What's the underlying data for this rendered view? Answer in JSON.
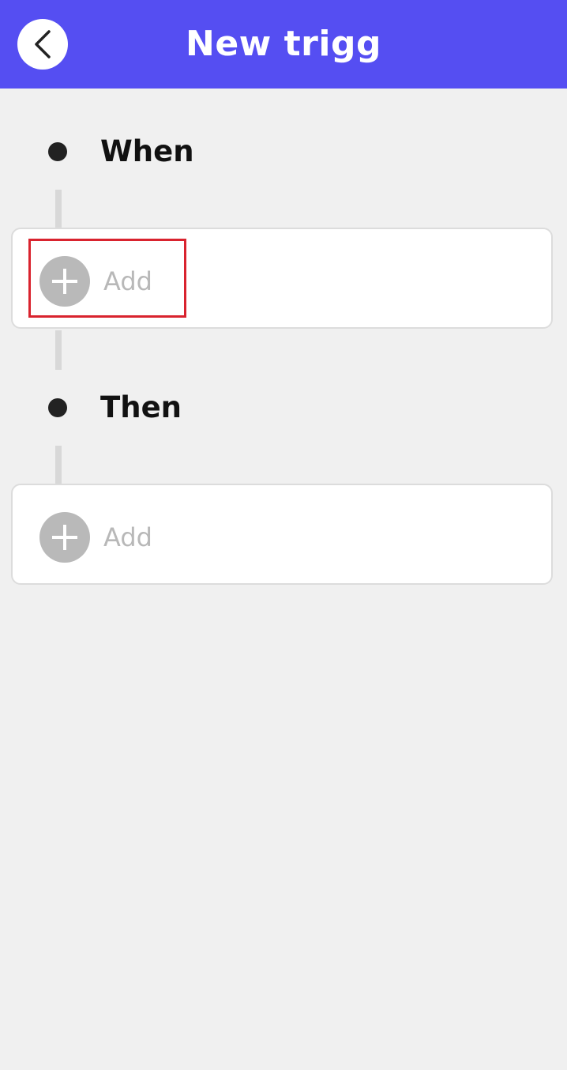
{
  "header": {
    "title": "New trigg",
    "back_icon": "chevron-left-icon"
  },
  "sections": {
    "when": {
      "label": "When",
      "add_label": "Add"
    },
    "then": {
      "label": "Then",
      "add_label": "Add"
    }
  },
  "colors": {
    "header_bg": "#554ef2",
    "page_bg": "#f0f0f0",
    "highlight": "#d9232e",
    "plus_circle": "#b9b9b9"
  }
}
